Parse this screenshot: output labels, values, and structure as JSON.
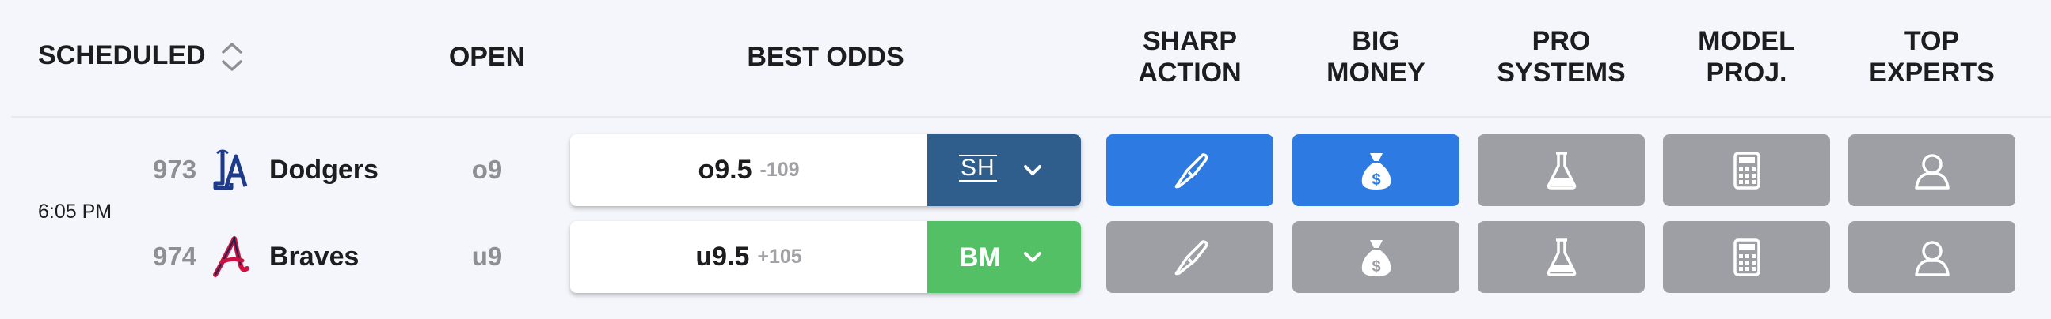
{
  "headers": {
    "scheduled": "SCHEDULED",
    "open": "OPEN",
    "best_odds": "BEST ODDS",
    "sharp_action": [
      "SHARP",
      "ACTION"
    ],
    "big_money": [
      "BIG",
      "MONEY"
    ],
    "pro_systems": [
      "PRO",
      "SYSTEMS"
    ],
    "model_proj": [
      "MODEL",
      "PROJ."
    ],
    "top_experts": [
      "TOP",
      "EXPERTS"
    ]
  },
  "game": {
    "time": "6:05 PM",
    "teams": [
      {
        "rotation": "973",
        "name": "Dodgers",
        "logo": "dodgers-la-logo",
        "open": "o9",
        "best_line": "o9.5",
        "best_price": "-109",
        "book": "SH",
        "book_color": "#2f5d8c",
        "signals": {
          "sharp_action": true,
          "big_money": true,
          "pro_systems": false,
          "model_proj": false,
          "top_experts": false
        }
      },
      {
        "rotation": "974",
        "name": "Braves",
        "logo": "braves-a-logo",
        "open": "u9",
        "best_line": "u9.5",
        "best_price": "+105",
        "book": "BM",
        "book_color": "#54c065",
        "signals": {
          "sharp_action": false,
          "big_money": false,
          "pro_systems": false,
          "model_proj": false,
          "top_experts": false
        }
      }
    ]
  },
  "colors": {
    "active_tile": "#2d7be2",
    "inactive_tile": "#9e9fa4",
    "background": "#f4f6fb"
  },
  "icons": [
    "sort-icon",
    "knife-icon",
    "money-bag-icon",
    "flask-icon",
    "calculator-icon",
    "user-icon",
    "chevron-down-icon"
  ]
}
